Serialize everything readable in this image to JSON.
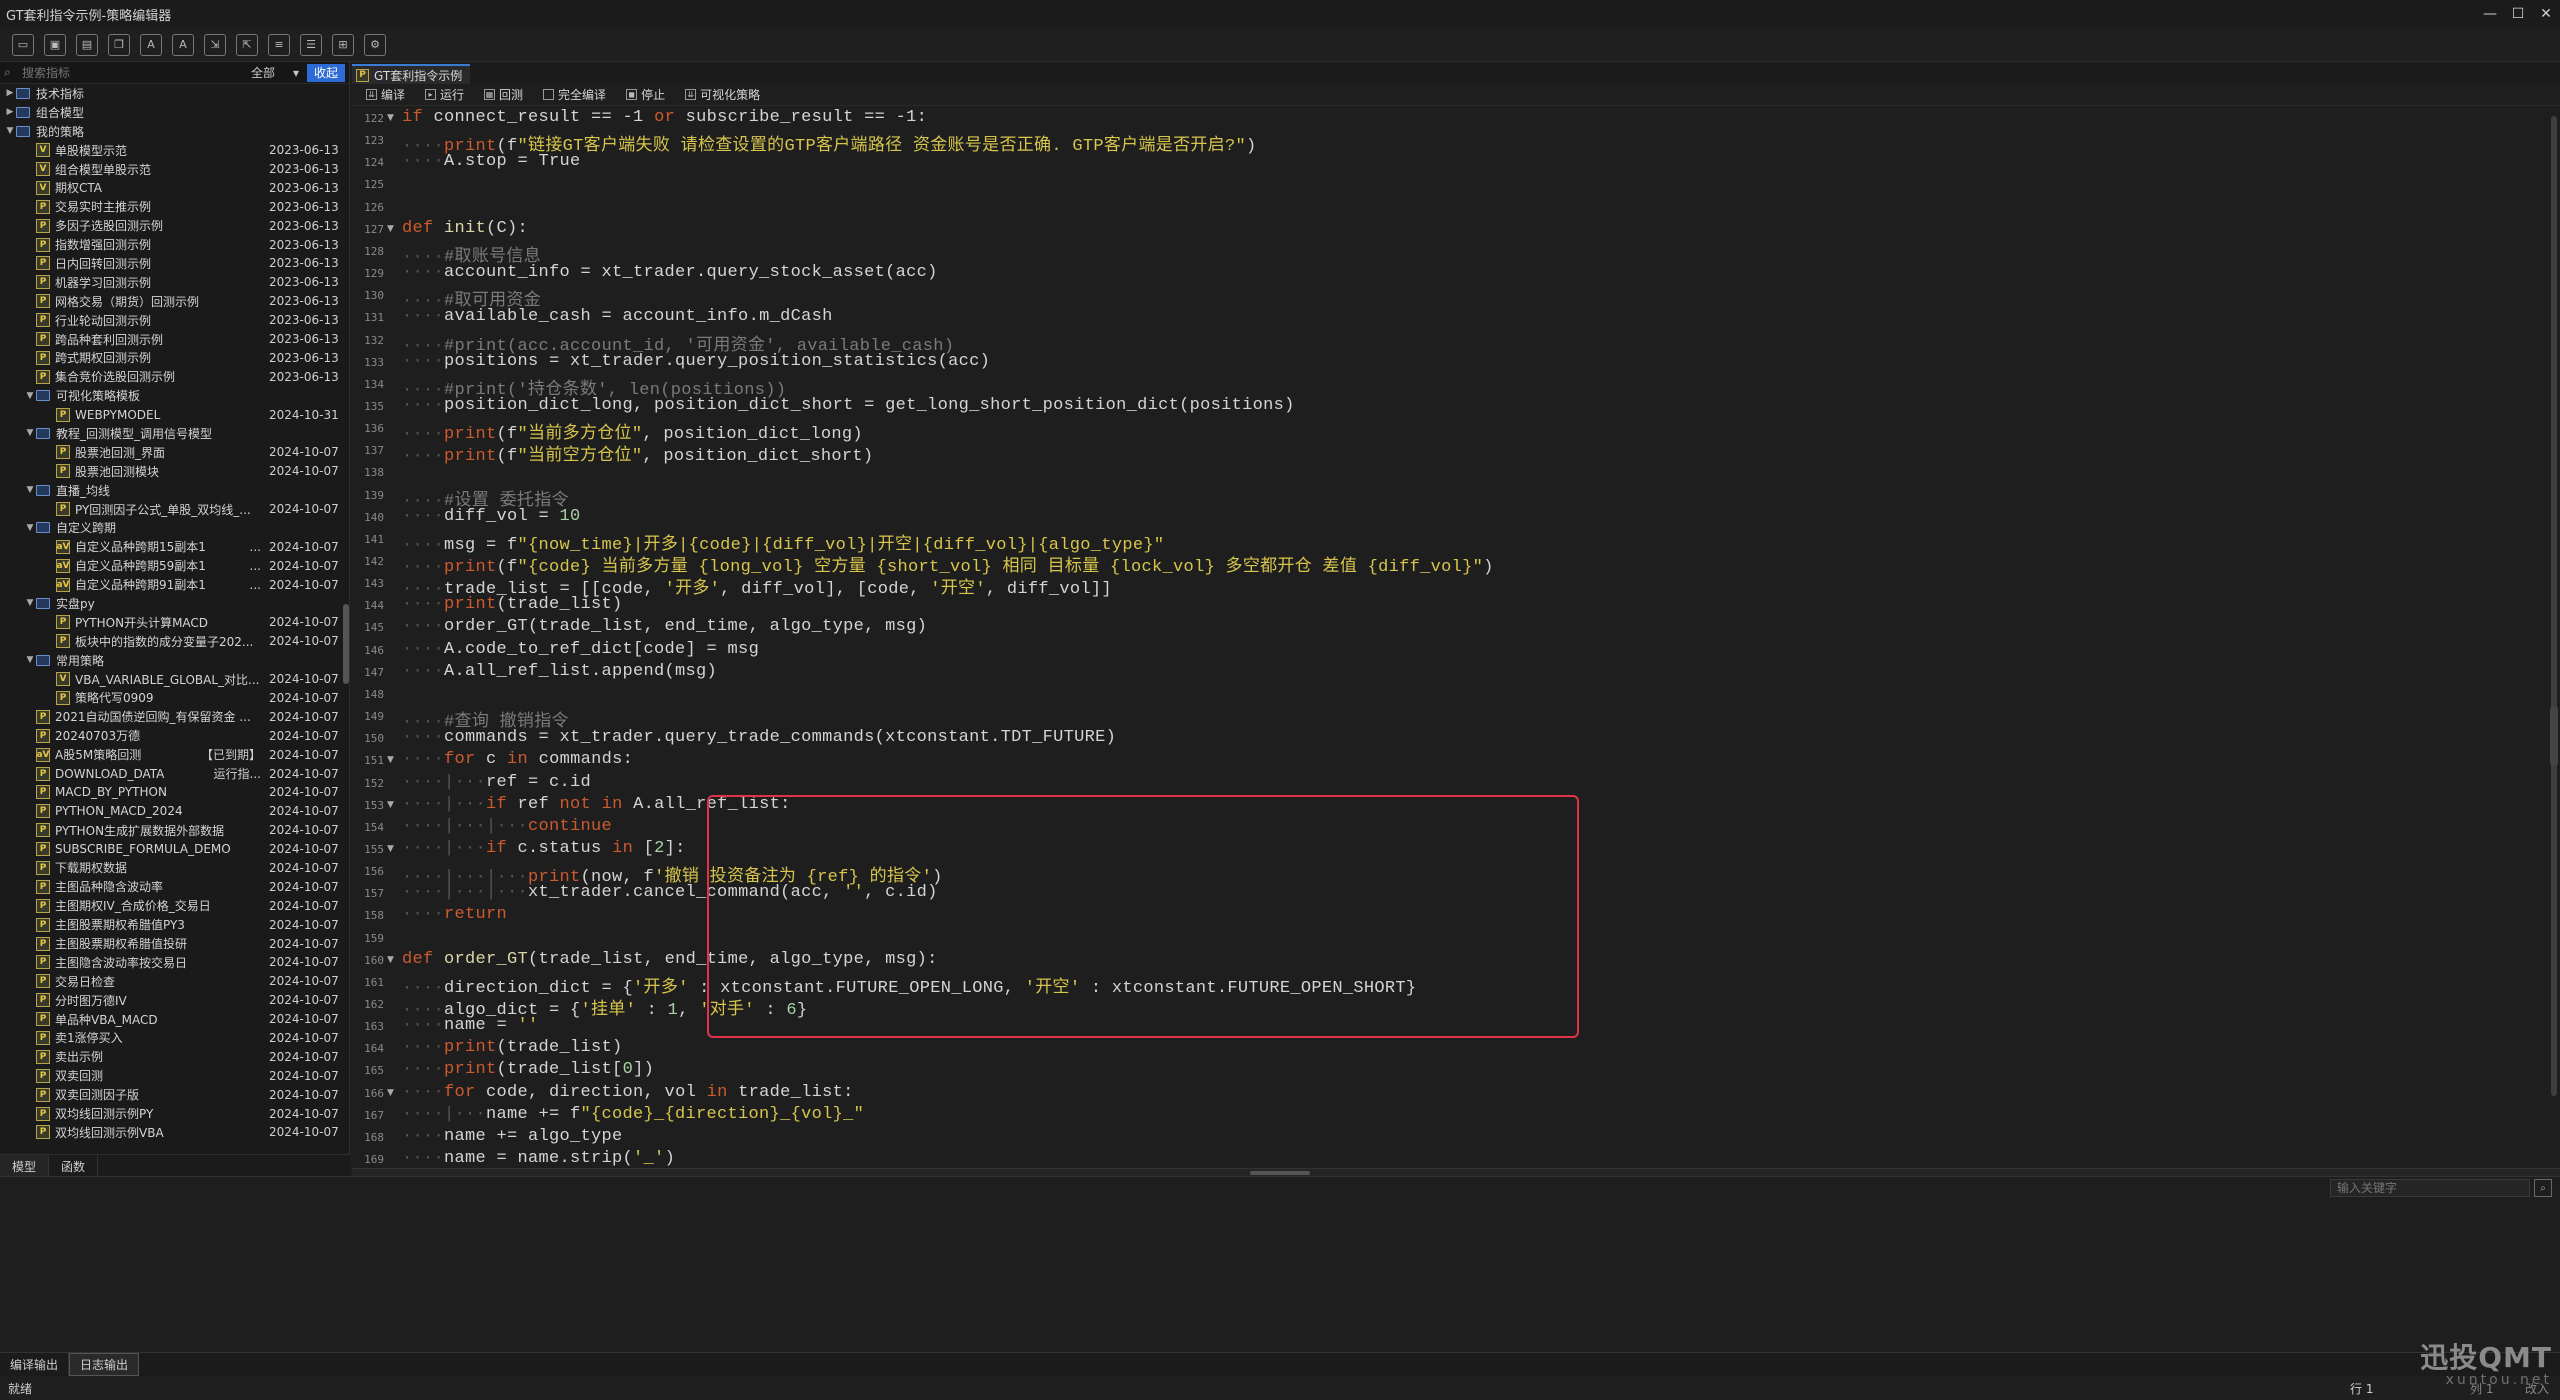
{
  "window": {
    "title": "GT套利指令示例-策略编辑器",
    "controls": [
      "—",
      "☐",
      "✕"
    ]
  },
  "toolbar": {
    "buttons": [
      {
        "icon": "new-file-icon",
        "glyph": "▭"
      },
      {
        "icon": "save-icon",
        "glyph": "▣"
      },
      {
        "icon": "save-as-icon",
        "glyph": "▤"
      },
      {
        "icon": "copy-icon",
        "glyph": "❐"
      },
      {
        "icon": "font-decrease-icon",
        "glyph": "A"
      },
      {
        "icon": "font-increase-icon",
        "glyph": "A"
      },
      {
        "icon": "import-icon",
        "glyph": "⇲"
      },
      {
        "icon": "export-icon",
        "glyph": "⇱"
      },
      {
        "icon": "doc-icon",
        "glyph": "≡"
      },
      {
        "icon": "doc-list-icon",
        "glyph": "☰"
      },
      {
        "icon": "doc-grid-icon",
        "glyph": "⊞"
      },
      {
        "icon": "doc-settings-icon",
        "glyph": "⚙"
      }
    ]
  },
  "left": {
    "search_placeholder": "搜索指标",
    "filter_value": "全部",
    "collapse_label": "收起",
    "tabs": [
      "模型",
      "函数"
    ],
    "tree": [
      {
        "depth": 0,
        "type": "folder",
        "arrow": "▶",
        "label": "技术指标",
        "date": ""
      },
      {
        "depth": 0,
        "type": "folder",
        "arrow": "▶",
        "label": "组合模型",
        "date": ""
      },
      {
        "depth": 0,
        "type": "folder",
        "arrow": "▼",
        "label": "我的策略",
        "date": ""
      },
      {
        "depth": 1,
        "type": "file",
        "badge": "V",
        "label": "单股模型示范",
        "date": "2023-06-13"
      },
      {
        "depth": 1,
        "type": "file",
        "badge": "V",
        "label": "组合模型单股示范",
        "date": "2023-06-13"
      },
      {
        "depth": 1,
        "type": "file",
        "badge": "V",
        "label": "期权CTA",
        "date": "2023-06-13"
      },
      {
        "depth": 1,
        "type": "file",
        "badge": "P",
        "label": "交易实时主推示例",
        "date": "2023-06-13"
      },
      {
        "depth": 1,
        "type": "file",
        "badge": "P",
        "label": "多因子选股回测示例",
        "date": "2023-06-13"
      },
      {
        "depth": 1,
        "type": "file",
        "badge": "P",
        "label": "指数增强回测示例",
        "date": "2023-06-13"
      },
      {
        "depth": 1,
        "type": "file",
        "badge": "P",
        "label": "日内回转回测示例",
        "date": "2023-06-13"
      },
      {
        "depth": 1,
        "type": "file",
        "badge": "P",
        "label": "机器学习回测示例",
        "date": "2023-06-13"
      },
      {
        "depth": 1,
        "type": "file",
        "badge": "P",
        "label": "网格交易（期货）回测示例",
        "date": "2023-06-13"
      },
      {
        "depth": 1,
        "type": "file",
        "badge": "P",
        "label": "行业轮动回测示例",
        "date": "2023-06-13"
      },
      {
        "depth": 1,
        "type": "file",
        "badge": "P",
        "label": "跨品种套利回测示例",
        "date": "2023-06-13"
      },
      {
        "depth": 1,
        "type": "file",
        "badge": "P",
        "label": "跨式期权回测示例",
        "date": "2023-06-13"
      },
      {
        "depth": 1,
        "type": "file",
        "badge": "P",
        "label": "集合竞价选股回测示例",
        "date": "2023-06-13"
      },
      {
        "depth": 1,
        "type": "folder",
        "arrow": "▼",
        "label": "可视化策略模板",
        "date": ""
      },
      {
        "depth": 2,
        "type": "file",
        "badge": "P",
        "label": "WEBPYMODEL",
        "date": "2024-10-31"
      },
      {
        "depth": 1,
        "type": "folder",
        "arrow": "▼",
        "label": "教程_回测模型_调用信号模型",
        "date": ""
      },
      {
        "depth": 2,
        "type": "file",
        "badge": "P",
        "label": "股票池回测_界面",
        "date": "2024-10-07"
      },
      {
        "depth": 2,
        "type": "file",
        "badge": "P",
        "label": "股票池回测模块",
        "date": "2024-10-07"
      },
      {
        "depth": 1,
        "type": "folder",
        "arrow": "▼",
        "label": "直播_均线",
        "date": ""
      },
      {
        "depth": 2,
        "type": "file",
        "badge": "P",
        "label": "PY回测因子公式_单股_双均线_...",
        "date": "2024-10-07"
      },
      {
        "depth": 1,
        "type": "folder",
        "arrow": "▼",
        "label": "自定义跨期",
        "date": ""
      },
      {
        "depth": 2,
        "type": "file",
        "badge": "aV",
        "label": "自定义品种跨期15副本1",
        "extra": "...",
        "date": "2024-10-07"
      },
      {
        "depth": 2,
        "type": "file",
        "badge": "aV",
        "label": "自定义品种跨期59副本1",
        "extra": "...",
        "date": "2024-10-07"
      },
      {
        "depth": 2,
        "type": "file",
        "badge": "aV",
        "label": "自定义品种跨期91副本1",
        "extra": "...",
        "date": "2024-10-07"
      },
      {
        "depth": 1,
        "type": "folder",
        "arrow": "▼",
        "label": "实盘py",
        "date": ""
      },
      {
        "depth": 2,
        "type": "file",
        "badge": "P",
        "label": "PYTHON开头计算MACD",
        "date": "2024-10-07"
      },
      {
        "depth": 2,
        "type": "file",
        "badge": "P",
        "label": "板块中的指数的成分变量子202...",
        "date": "2024-10-07"
      },
      {
        "depth": 1,
        "type": "folder",
        "arrow": "▼",
        "label": "常用策略",
        "date": ""
      },
      {
        "depth": 2,
        "type": "file",
        "badge": "V",
        "label": "VBA_VARIABLE_GLOBAL_对比...",
        "date": "2024-10-07"
      },
      {
        "depth": 2,
        "type": "file",
        "badge": "P",
        "label": "策略代写0909",
        "date": "2024-10-07"
      },
      {
        "depth": 1,
        "type": "file",
        "badge": "P",
        "label": "2021自动国债逆回购_有保留资金 ...",
        "date": "2024-10-07"
      },
      {
        "depth": 1,
        "type": "file",
        "badge": "P",
        "label": "20240703万德",
        "date": "2024-10-07"
      },
      {
        "depth": 1,
        "type": "file",
        "badge": "aV",
        "label": "A股5M策略回测",
        "extra": "【已到期】",
        "date": "2024-10-07"
      },
      {
        "depth": 1,
        "type": "file",
        "badge": "P",
        "label": "DOWNLOAD_DATA",
        "extra": "运行指...",
        "date": "2024-10-07"
      },
      {
        "depth": 1,
        "type": "file",
        "badge": "P",
        "label": "MACD_BY_PYTHON",
        "date": "2024-10-07"
      },
      {
        "depth": 1,
        "type": "file",
        "badge": "P",
        "label": "PYTHON_MACD_2024",
        "date": "2024-10-07"
      },
      {
        "depth": 1,
        "type": "file",
        "badge": "P",
        "label": "PYTHON生成扩展数据外部数据",
        "date": "2024-10-07"
      },
      {
        "depth": 1,
        "type": "file",
        "badge": "P",
        "label": "SUBSCRIBE_FORMULA_DEMO",
        "date": "2024-10-07"
      },
      {
        "depth": 1,
        "type": "file",
        "badge": "P",
        "label": "下载期权数据",
        "date": "2024-10-07"
      },
      {
        "depth": 1,
        "type": "file",
        "badge": "P",
        "label": "主图品种隐含波动率",
        "date": "2024-10-07"
      },
      {
        "depth": 1,
        "type": "file",
        "badge": "P",
        "label": "主图期权IV_合成价格_交易日",
        "date": "2024-10-07"
      },
      {
        "depth": 1,
        "type": "file",
        "badge": "P",
        "label": "主图股票期权希腊值PY3",
        "date": "2024-10-07"
      },
      {
        "depth": 1,
        "type": "file",
        "badge": "P",
        "label": "主图股票期权希腊值投研",
        "date": "2024-10-07"
      },
      {
        "depth": 1,
        "type": "file",
        "badge": "P",
        "label": "主图隐含波动率按交易日",
        "date": "2024-10-07"
      },
      {
        "depth": 1,
        "type": "file",
        "badge": "P",
        "label": "交易日检查",
        "date": "2024-10-07"
      },
      {
        "depth": 1,
        "type": "file",
        "badge": "P",
        "label": "分时图万德IV",
        "date": "2024-10-07"
      },
      {
        "depth": 1,
        "type": "file",
        "badge": "P",
        "label": "单品种VBA_MACD",
        "date": "2024-10-07"
      },
      {
        "depth": 1,
        "type": "file",
        "badge": "P",
        "label": "卖1涨停买入",
        "date": "2024-10-07"
      },
      {
        "depth": 1,
        "type": "file",
        "badge": "P",
        "label": "卖出示例",
        "date": "2024-10-07"
      },
      {
        "depth": 1,
        "type": "file",
        "badge": "P",
        "label": "双卖回测",
        "date": "2024-10-07"
      },
      {
        "depth": 1,
        "type": "file",
        "badge": "P",
        "label": "双卖回测因子版",
        "date": "2024-10-07"
      },
      {
        "depth": 1,
        "type": "file",
        "badge": "P",
        "label": "双均线回测示例PY",
        "date": "2024-10-07"
      },
      {
        "depth": 1,
        "type": "file",
        "badge": "P",
        "label": "双均线回测示例VBA",
        "date": "2024-10-07"
      }
    ]
  },
  "editor": {
    "tab_label": "GT套利指令示例",
    "actions": [
      {
        "icon": "compile-icon",
        "glyph": "⇊",
        "label": "编译"
      },
      {
        "icon": "run-icon",
        "glyph": "▸",
        "label": "运行"
      },
      {
        "icon": "backtest-icon",
        "glyph": "▦",
        "label": "回测"
      },
      {
        "icon": "full-compile-icon",
        "glyph": "",
        "label": "完全编译"
      },
      {
        "icon": "stop-icon",
        "glyph": "◼",
        "label": "停止"
      },
      {
        "icon": "visual-strategy-icon",
        "glyph": "⇊",
        "label": "可视化策略"
      }
    ],
    "lines": [
      {
        "n": "122",
        "fold": "▼",
        "html": "<span class='kw'>if</span> connect_result == -1 <span class='kw'>or</span> subscribe_result == -1:"
      },
      {
        "n": "123",
        "fold": "",
        "html": "<span class='ind'>····</span><span class='kw'>print</span>(f<span class='str'>\"链接GT客户端失败 请检查设置的GTP客户端路径 资金账号是否正确. GTP客户端是否开启?\"</span>)"
      },
      {
        "n": "124",
        "fold": "",
        "html": "<span class='ind'>····</span>A.stop = True"
      },
      {
        "n": "125",
        "fold": "",
        "html": ""
      },
      {
        "n": "126",
        "fold": "",
        "html": ""
      },
      {
        "n": "127",
        "fold": "▼",
        "html": "<span class='kw'>def</span> <span class='fn'>init</span>(C):"
      },
      {
        "n": "128",
        "fold": "",
        "html": "<span class='ind'>····</span><span class='cm'>#取账号信息</span>"
      },
      {
        "n": "129",
        "fold": "",
        "html": "<span class='ind'>····</span>account_info = xt_trader.query_stock_asset(acc)"
      },
      {
        "n": "130",
        "fold": "",
        "html": "<span class='ind'>····</span><span class='cm'>#取可用资金</span>"
      },
      {
        "n": "131",
        "fold": "",
        "html": "<span class='ind'>····</span>available_cash = account_info.m_dCash"
      },
      {
        "n": "132",
        "fold": "",
        "html": "<span class='ind'>····</span><span class='cm'>#print(acc.account_id, '可用资金', available_cash)</span>"
      },
      {
        "n": "133",
        "fold": "",
        "html": "<span class='ind'>····</span>positions = xt_trader.query_position_statistics(acc)"
      },
      {
        "n": "134",
        "fold": "",
        "html": "<span class='ind'>····</span><span class='cm'>#print('持仓条数', len(positions))</span>"
      },
      {
        "n": "135",
        "fold": "",
        "html": "<span class='ind'>····</span>position_dict_long, position_dict_short = get_long_short_position_dict(positions)"
      },
      {
        "n": "136",
        "fold": "",
        "html": "<span class='ind'>····</span><span class='kw'>print</span>(f<span class='str'>\"当前多方仓位\"</span>, position_dict_long)"
      },
      {
        "n": "137",
        "fold": "",
        "html": "<span class='ind'>····</span><span class='kw'>print</span>(f<span class='str'>\"当前空方仓位\"</span>, position_dict_short)"
      },
      {
        "n": "138",
        "fold": "",
        "html": ""
      },
      {
        "n": "139",
        "fold": "",
        "html": "<span class='ind'>····</span><span class='cm'>#设置 委托指令</span>"
      },
      {
        "n": "140",
        "fold": "",
        "html": "<span class='ind'>····</span>diff_vol = <span class='num'>10</span>"
      },
      {
        "n": "141",
        "fold": "",
        "html": "<span class='ind'>····</span>msg = f<span class='str'>\"{now_time}|开多|{code}|{diff_vol}|开空|{diff_vol}|{algo_type}\"</span>"
      },
      {
        "n": "142",
        "fold": "",
        "html": "<span class='ind'>····</span><span class='kw'>print</span>(f<span class='str'>\"{code} 当前多方量 {long_vol} 空方量 {short_vol} 相同 目标量 {lock_vol} 多空都开仓 差值 {diff_vol}\"</span>)"
      },
      {
        "n": "143",
        "fold": "",
        "html": "<span class='ind'>····</span>trade_list = [[code, <span class='str'>'开多'</span>, diff_vol], [code, <span class='str'>'开空'</span>, diff_vol]]"
      },
      {
        "n": "144",
        "fold": "",
        "html": "<span class='ind'>····</span><span class='kw'>print</span>(trade_list)"
      },
      {
        "n": "145",
        "fold": "",
        "html": "<span class='ind'>····</span>order_GT(trade_list, end_time, algo_type, msg)"
      },
      {
        "n": "146",
        "fold": "",
        "html": "<span class='ind'>····</span>A.code_to_ref_dict[code] = msg"
      },
      {
        "n": "147",
        "fold": "",
        "html": "<span class='ind'>····</span>A.all_ref_list.append(msg)"
      },
      {
        "n": "148",
        "fold": "",
        "html": ""
      },
      {
        "n": "149",
        "fold": "",
        "html": "<span class='ind'>····</span><span class='cm'>#查询 撤销指令</span>"
      },
      {
        "n": "150",
        "fold": "",
        "html": "<span class='ind'>····</span>commands = xt_trader.query_trade_commands(xtconstant.TDT_FUTURE)"
      },
      {
        "n": "151",
        "fold": "▼",
        "html": "<span class='ind'>····</span><span class='kw'>for</span> c <span class='kw'>in</span> commands:"
      },
      {
        "n": "152",
        "fold": "",
        "html": "<span class='ind'>····|···</span>ref = c.id"
      },
      {
        "n": "153",
        "fold": "▼",
        "html": "<span class='ind'>····|···</span><span class='kw'>if</span> ref <span class='kw'>not</span> <span class='kw'>in</span> A.all_ref_list:"
      },
      {
        "n": "154",
        "fold": "",
        "html": "<span class='ind'>····|···|···</span><span class='kw'>continue</span>"
      },
      {
        "n": "155",
        "fold": "▼",
        "html": "<span class='ind'>····|···</span><span class='kw'>if</span> c.status <span class='kw'>in</span> [<span class='num'>2</span>]:"
      },
      {
        "n": "156",
        "fold": "",
        "html": "<span class='ind'>····|···|···</span><span class='kw'>print</span>(now, f<span class='str'>'撤销 投资备注为 {ref} 的指令'</span>)"
      },
      {
        "n": "157",
        "fold": "",
        "html": "<span class='ind'>····|···|···</span>xt_trader.cancel_command(acc, <span class='str'>''</span>, c.id)"
      },
      {
        "n": "158",
        "fold": "",
        "html": "<span class='ind'>····</span><span class='kw'>return</span>"
      },
      {
        "n": "159",
        "fold": "",
        "html": ""
      },
      {
        "n": "160",
        "fold": "▼",
        "html": "<span class='kw'>def</span> <span class='fn'>order_GT</span>(trade_list, end_time, algo_type, msg):"
      },
      {
        "n": "161",
        "fold": "",
        "html": "<span class='ind'>····</span>direction_dict = {<span class='str'>'开多'</span> : xtconstant.FUTURE_OPEN_LONG, <span class='str'>'开空'</span> : xtconstant.FUTURE_OPEN_SHORT}"
      },
      {
        "n": "162",
        "fold": "",
        "html": "<span class='ind'>····</span>algo_dict = {<span class='str'>'挂单'</span> : <span class='num'>1</span>, <span class='str'>'对手'</span> : <span class='num'>6</span>}"
      },
      {
        "n": "163",
        "fold": "",
        "html": "<span class='ind'>····</span>name = <span class='str'>''</span>"
      },
      {
        "n": "164",
        "fold": "",
        "html": "<span class='ind'>····</span><span class='kw'>print</span>(trade_list)"
      },
      {
        "n": "165",
        "fold": "",
        "html": "<span class='ind'>····</span><span class='kw'>print</span>(trade_list[<span class='num'>0</span>])"
      },
      {
        "n": "166",
        "fold": "▼",
        "html": "<span class='ind'>····</span><span class='kw'>for</span> code, direction, vol <span class='kw'>in</span> trade_list:"
      },
      {
        "n": "167",
        "fold": "",
        "html": "<span class='ind'>····|···</span>name += f<span class='str'>\"{code}_{direction}_{vol}_\"</span>"
      },
      {
        "n": "168",
        "fold": "",
        "html": "<span class='ind'>····</span>name += algo_type"
      },
      {
        "n": "169",
        "fold": "",
        "html": "<span class='ind'>····</span>name = name.strip(<span class='str'>'_'</span>)"
      }
    ]
  },
  "output": {
    "keyword_placeholder": "输入关键字",
    "tabs": [
      "编译输出",
      "日志输出"
    ]
  },
  "status": {
    "text": "就绪",
    "line": "行 1",
    "col": "列 1",
    "extra": "改入"
  },
  "watermark": {
    "brand": "迅投QMT",
    "domain": "xuntou.net"
  }
}
